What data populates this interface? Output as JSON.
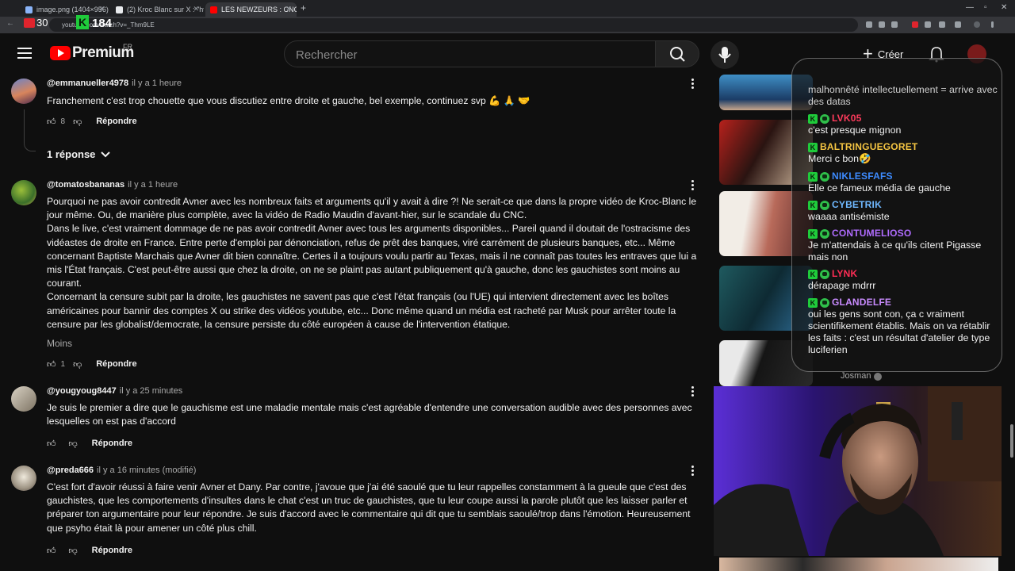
{
  "browser": {
    "tabs": [
      {
        "title": "image.png (1404×956)"
      },
      {
        "title": "(2) Kroc Blanc sur X : \"https://..."
      },
      {
        "title": "LES NEWZEURS : CNC TALENT..."
      }
    ],
    "new_tab": "+",
    "url": "youtube.com/watch?v=_Thm9LE",
    "overlay_counter": "184",
    "overlay_prefix": "30"
  },
  "youtube": {
    "logo_text": "Premium",
    "country": "FR",
    "search_placeholder": "Rechercher",
    "create_label": "Créer"
  },
  "comments": [
    {
      "author": "@emmanueller4978",
      "time": "il y a 1 heure",
      "paragraphs": [
        "Franchement c'est trop chouette que vous discutiez entre droite et gauche, bel exemple, continuez svp 💪 🙏 🤝"
      ],
      "likes": "8",
      "reply_label": "Répondre"
    },
    {
      "author": "@tomatosbananas",
      "time": "il y a 1 heure",
      "paragraphs": [
        "Pourquoi ne pas avoir contredit Avner avec les nombreux faits et arguments qu'il y avait à dire ?! Ne serait-ce que dans la propre vidéo de Kroc-Blanc le jour même. Ou, de manière plus complète, avec la vidéo de  Radio Maudin d'avant-hier, sur le scandale du CNC.",
        "Dans le live, c'est vraiment dommage de ne pas avoir contredit Avner avec tous les arguments disponibles... Pareil quand il doutait de l'ostracisme des vidéastes de droite en France. Entre perte d'emploi par dénonciation, refus de prêt des banques, viré carrément de plusieurs banques, etc... Même concernant Baptiste Marchais que Avner dit bien connaître. Certes il a toujours voulu partir au Texas, mais il ne connaît pas toutes les entraves que lui a mis l'État français. C'est peut-être aussi que chez la droite, on ne se plaint pas autant publiquement qu'à gauche, donc les gauchistes sont moins au courant.",
        "Concernant la censure subit par la droite, les gauchistes ne savent pas que c'est l'état français (ou l'UE) qui intervient directement avec les boîtes américaines pour bannir des comptes X ou strike des vidéos youtube, etc... Donc même quand un média est racheté par Musk pour arrêter toute la censure par les globalist/democrate, la censure persiste du côté européen à cause de l'intervention étatique."
      ],
      "less_label": "Moins",
      "likes": "1",
      "reply_label": "Répondre"
    },
    {
      "author": "@yougyoug8447",
      "time": "il y a 25 minutes",
      "paragraphs": [
        "Je suis le premier a dire que le gauchisme est une maladie mentale mais c'est agréable d'entendre une conversation audible avec des personnes avec lesquelles on est pas d'accord"
      ],
      "likes": "",
      "reply_label": "Répondre"
    },
    {
      "author": "@preda666",
      "time": "il y a 16 minutes (modifié)",
      "paragraphs": [
        "C'est fort d'avoir réussi à faire venir Avner et Dany. Par contre, j'avoue que j'ai été saoulé que tu leur rappelles constamment à la gueule que c'est des gauchistes, que les comportements d'insultes dans le chat c'est un truc de gauchistes, que tu leur coupe aussi la parole plutôt que les laisser parler et préparer ton argumentaire pour leur répondre. Je suis d'accord avec le commentaire qui dit que tu semblais saoulé/trop dans l'émotion. Heureusement que psyho était là pour amener un côté plus chill."
      ],
      "likes": "",
      "reply_label": "Répondre"
    }
  ],
  "replies_toggle": "1 réponse",
  "sidebar": {
    "channel_name": "Josman"
  },
  "chat": [
    {
      "user": "",
      "color": "#ffffff",
      "text": "malhonnêté intellectuellement = arrive avec des datas"
    },
    {
      "user": "LVK05",
      "color": "#ff3b5c",
      "text": "c'est presque mignon"
    },
    {
      "user": "BALTRINGUEGORET",
      "color": "#f5c542",
      "text": "Merci c bon🤣"
    },
    {
      "user": "NIKLESFAFS",
      "color": "#3d8bff",
      "text": "Elle ce fameux média de gauche"
    },
    {
      "user": "CYBETRIK",
      "color": "#6fb8ff",
      "text": "waaaa antisémiste"
    },
    {
      "user": "CONTUMELIOSO",
      "color": "#b06cff",
      "text": "Je m'attendais à ce qu'ils citent Pigasse mais non"
    },
    {
      "user": "LYNK",
      "color": "#ff2d55",
      "text": "dérapage mdrrr"
    },
    {
      "user": "GLANDELFE",
      "color": "#c98bff",
      "text": "oui les gens sont con, ça c vraiment scientifikement établis. Mais on va rétablir les faits : c'est un résultat d'atelier de type luciferien"
    }
  ],
  "colors": {
    "background": "#0f0f0f",
    "youtube_red": "#ff0000",
    "kick_green": "#1fcc3b"
  }
}
